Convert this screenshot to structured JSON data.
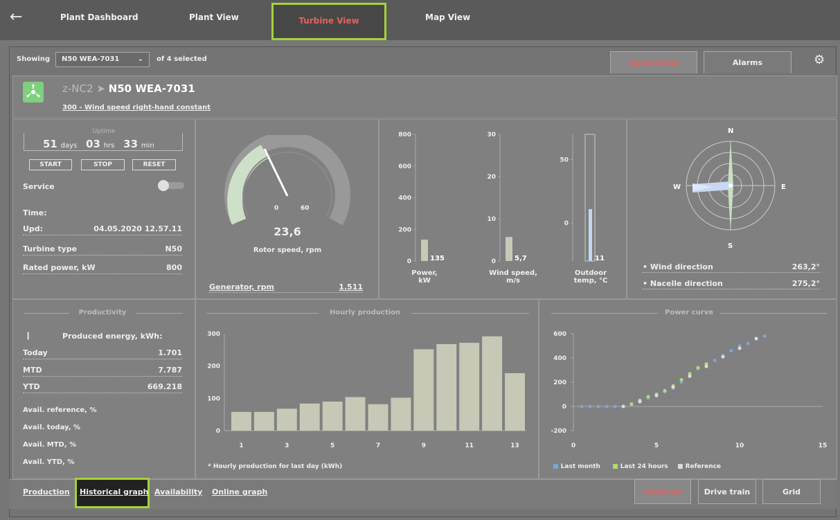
{
  "nav": {
    "tabs": [
      "Plant Dashboard",
      "Plant View",
      "Turbine View",
      "Map View"
    ],
    "active_tab": "Turbine View"
  },
  "filter": {
    "showing_label": "Showing",
    "selected": "N50 WEA-7031",
    "count_text": "of 4 selected"
  },
  "view_tabs": [
    "Operational",
    "Alarms"
  ],
  "turbine": {
    "group": "z-NC2",
    "name": "N50 WEA-7031",
    "status": "300 - Wind speed right-hand constant"
  },
  "uptime": {
    "label": "Uptime",
    "days": "51",
    "days_unit": "days",
    "hrs": "03",
    "hrs_unit": "hrs",
    "min": "33",
    "min_unit": "min",
    "buttons": [
      "START",
      "STOP",
      "RESET"
    ]
  },
  "info": {
    "service_label": "Service",
    "time_label": "Time:",
    "upd_label": "Upd:",
    "upd_value": "04.05.2020 12.57.11",
    "turbine_type_label": "Turbine type",
    "turbine_type_value": "N50",
    "rated_power_label": "Rated power, kW",
    "rated_power_value": "800"
  },
  "gauge": {
    "value": "23,6",
    "label": "Rotor speed, rpm",
    "tick_min": "0",
    "tick_max": "60",
    "generator_label": "Generator, rpm",
    "generator_value": "1.511"
  },
  "bars": {
    "power": {
      "ticks": [
        "800",
        "600",
        "400",
        "200",
        "0"
      ],
      "value": "135",
      "label1": "Power,",
      "label2": "kW"
    },
    "wind": {
      "ticks": [
        "30",
        "20",
        "10",
        "0"
      ],
      "value": "5,7",
      "label1": "Wind speed,",
      "label2": "m/s"
    },
    "temp": {
      "ticks": [
        "50",
        "0"
      ],
      "value": "11",
      "label1": "Outdoor",
      "label2": "temp, °C"
    }
  },
  "compass": {
    "n": "N",
    "s": "S",
    "e": "E",
    "w": "W",
    "wind_dir_label": "Wind direction",
    "wind_dir_value": "263,2°",
    "nacelle_label": "Nacelle direction",
    "nacelle_value": "275,2°"
  },
  "productivity": {
    "title": "Productivity",
    "produced_label": "Produced energy, kWh:",
    "today_label": "Today",
    "today_value": "1.701",
    "mtd_label": "MTD",
    "mtd_value": "7.787",
    "ytd_label": "YTD",
    "ytd_value": "669.218",
    "avail_ref": "Avail. reference, %",
    "avail_today": "Avail. today, %",
    "avail_mtd": "Avail. MTD, %",
    "avail_ytd": "Avail. YTD, %"
  },
  "hourly": {
    "title": "Hourly production",
    "legend": "Hourly production for last day (kWh)"
  },
  "power_curve": {
    "title": "Power curve",
    "legend": [
      "Last month",
      "Last 24 hours",
      "Reference"
    ]
  },
  "bottom_tabs": [
    "Production",
    "Historical graph",
    "Availability",
    "Online graph"
  ],
  "bottom_right_tabs": [
    "Overview",
    "Drive train",
    "Grid"
  ],
  "chart_data": [
    {
      "type": "bar",
      "title": "Hourly production",
      "categories": [
        "1",
        "2",
        "3",
        "4",
        "5",
        "6",
        "7",
        "8",
        "9",
        "10",
        "11",
        "12",
        "13"
      ],
      "x_tick_labels": [
        "1",
        "3",
        "5",
        "7",
        "9",
        "11",
        "13"
      ],
      "values": [
        58,
        58,
        68,
        84,
        90,
        104,
        82,
        102,
        252,
        268,
        272,
        292,
        178
      ],
      "ylim": [
        0,
        300
      ],
      "y_ticks": [
        "300",
        "200",
        "100",
        "0"
      ],
      "series_label": "Hourly production for last day (kWh)",
      "color": "#c7c8b6"
    },
    {
      "type": "scatter",
      "title": "Power curve",
      "xlim": [
        0,
        15
      ],
      "ylim": [
        -200,
        600
      ],
      "x_ticks": [
        "0",
        "5",
        "10",
        "15"
      ],
      "y_ticks": [
        "600",
        "400",
        "200",
        "0",
        "-200"
      ],
      "series": [
        {
          "name": "Last month",
          "color": "#7aa6d6",
          "x": [
            0.5,
            1,
            1.5,
            2,
            2.5,
            3,
            3.5,
            4,
            4.5,
            5,
            5.5,
            6,
            6.5,
            7,
            7.5,
            8,
            8.5,
            9,
            9.5,
            10,
            10.5,
            11,
            11.5
          ],
          "y": [
            0,
            0,
            0,
            0,
            0,
            0,
            10,
            40,
            70,
            90,
            120,
            150,
            200,
            260,
            310,
            350,
            380,
            420,
            460,
            500,
            520,
            560,
            580
          ]
        },
        {
          "name": "Last 24 hours",
          "color": "#b8dc6a",
          "x": [
            3.5,
            4,
            4.5,
            5,
            5.5,
            6,
            6.5,
            7,
            7.5,
            8
          ],
          "y": [
            20,
            50,
            80,
            100,
            130,
            170,
            220,
            270,
            320,
            350
          ]
        },
        {
          "name": "Reference",
          "color": "#dddddd",
          "x": [
            3,
            4,
            5,
            6,
            7,
            8,
            9,
            10,
            11
          ],
          "y": [
            0,
            40,
            90,
            160,
            250,
            330,
            410,
            480,
            560
          ]
        }
      ]
    },
    {
      "type": "bar",
      "title": "Power, kW",
      "categories": [
        "Power"
      ],
      "values": [
        135
      ],
      "ylim": [
        0,
        800
      ]
    },
    {
      "type": "bar",
      "title": "Wind speed, m/s",
      "categories": [
        "Wind speed"
      ],
      "values": [
        5.7
      ],
      "ylim": [
        0,
        30
      ]
    },
    {
      "type": "bar",
      "title": "Outdoor temp, °C",
      "categories": [
        "Outdoor temp"
      ],
      "values": [
        11
      ],
      "ylim": [
        -30,
        70
      ]
    }
  ]
}
